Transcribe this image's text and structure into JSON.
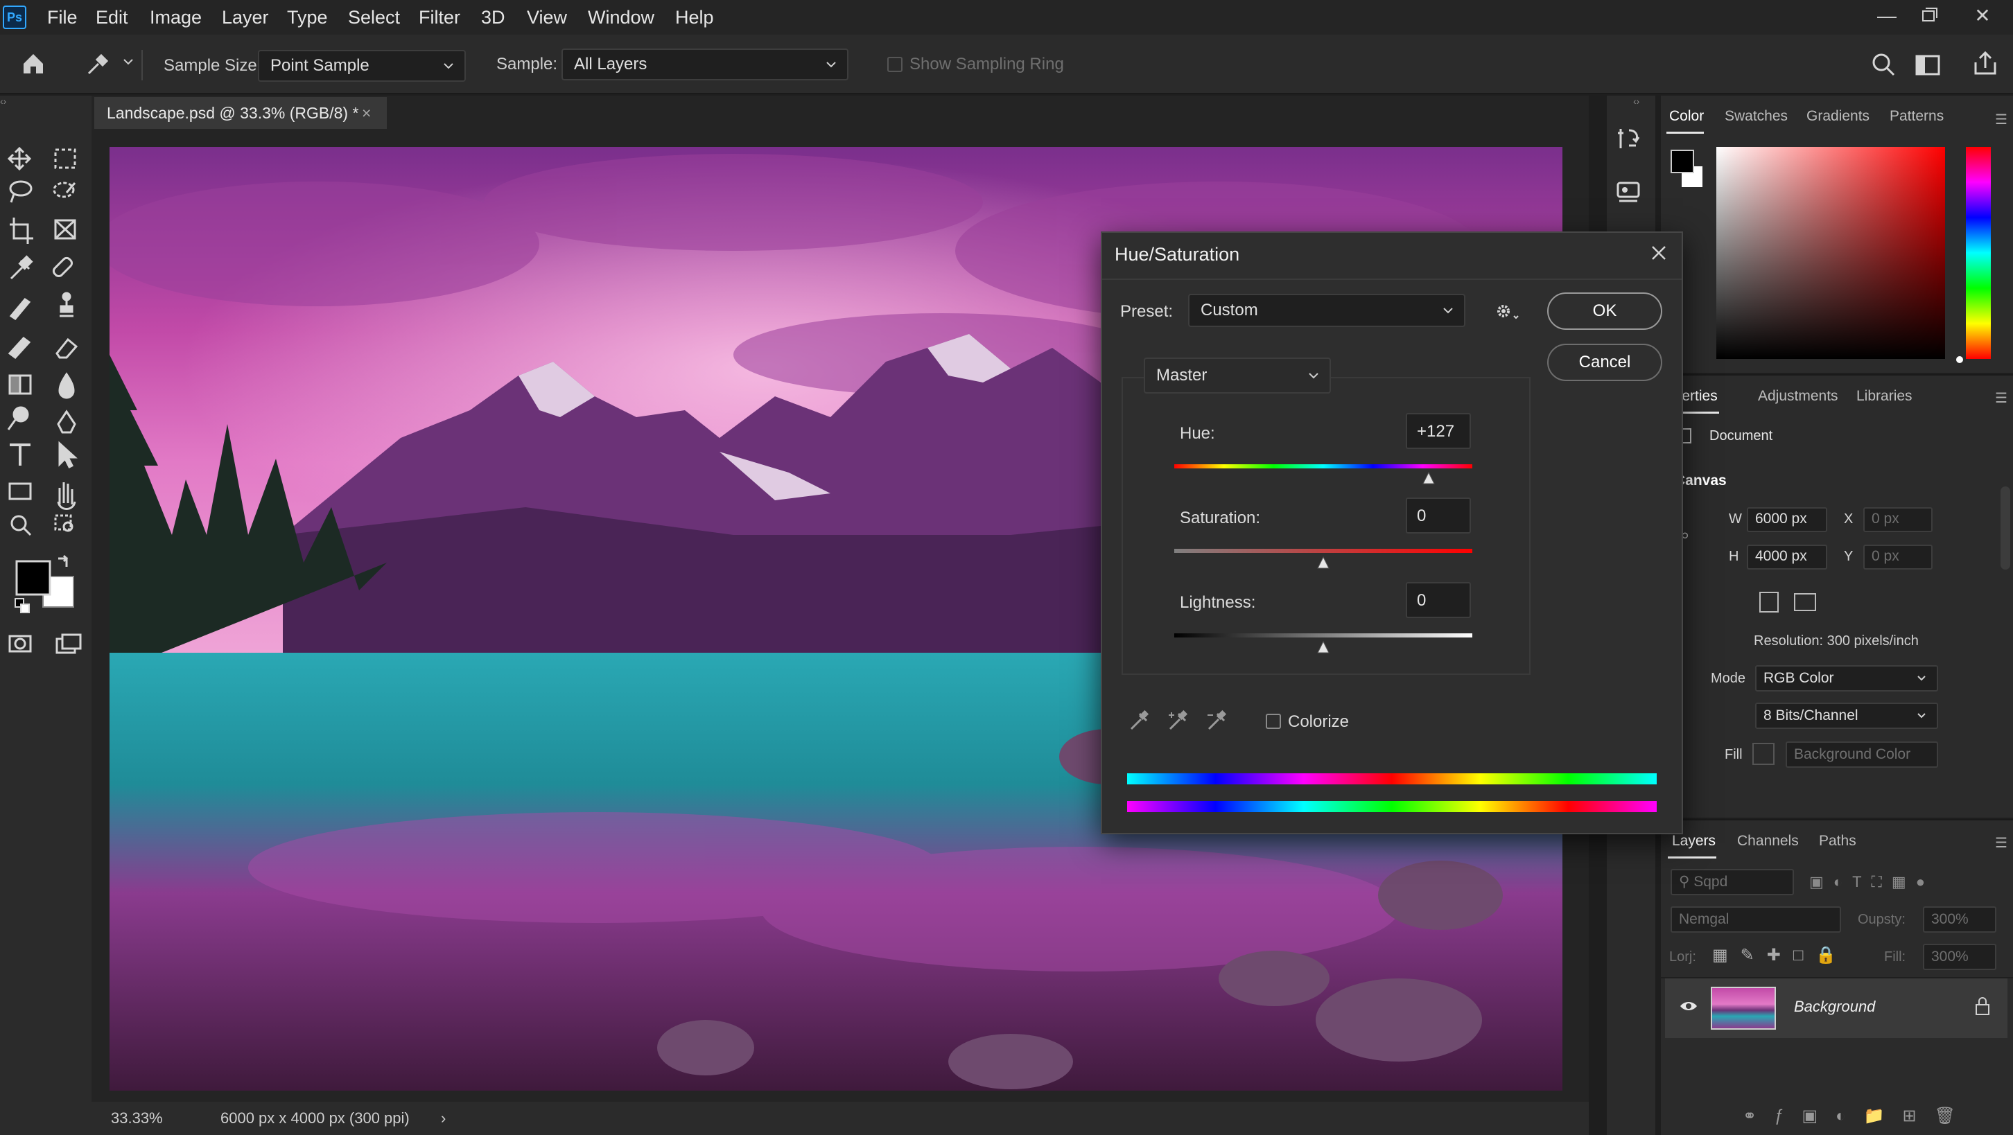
{
  "app": {
    "logo": "Ps"
  },
  "menu": [
    "File",
    "Edit",
    "Image",
    "Layer",
    "Type",
    "Select",
    "Filter",
    "3D",
    "View",
    "Window",
    "Help"
  ],
  "options": {
    "sample_size_label": "Sample Size:",
    "sample_size_value": "Point Sample",
    "sample_label": "Sample:",
    "sample_value": "All Layers",
    "sampling_ring_label": "Show Sampling Ring"
  },
  "document": {
    "tab_title": "Landscape.psd @ 33.3% (RGB/8) *",
    "zoom": "33.33%",
    "info": "6000 px x 4000 px (300 ppi)"
  },
  "color_panel": {
    "tabs": [
      "Color",
      "Swatches",
      "Gradients",
      "Patterns"
    ],
    "active_tab": "Color"
  },
  "properties_panel": {
    "tabs": [
      "roperties",
      "Adjustments",
      "Libraries"
    ],
    "document_label": "Document",
    "canvas_label": "Canvas",
    "w_label": "W",
    "w_value": "6000 px",
    "h_label": "H",
    "h_value": "4000 px",
    "x_label": "X",
    "x_value": "0 px",
    "y_label": "Y",
    "y_value": "0 px",
    "resolution": "Resolution: 300 pixels/inch",
    "mode_label": "Mode",
    "mode_value": "RGB Color",
    "bits_value": "8 Bits/Channel",
    "fill_label": "Fill",
    "fill_value": "Background Color"
  },
  "layers_panel": {
    "tabs": [
      "Layers",
      "Channels",
      "Paths"
    ],
    "search_placeholder": "Sqpd",
    "blend_mode": "Nemgal",
    "opacity_label": "Oupsty:",
    "opacity_value": "300%",
    "lock_label": "Lorj:",
    "fill_label": "Fill:",
    "fill_value": "300%",
    "layer_name": "Background"
  },
  "dialog": {
    "title": "Hue/Saturation",
    "preset_label": "Preset:",
    "preset_value": "Custom",
    "ok_label": "OK",
    "cancel_label": "Cancel",
    "channel_value": "Master",
    "hue_label": "Hue:",
    "hue_value": "+127",
    "hue_slider": 127,
    "saturation_label": "Saturation:",
    "saturation_value": "0",
    "saturation_slider": 0,
    "lightness_label": "Lightness:",
    "lightness_value": "0",
    "lightness_slider": 0,
    "colorize_label": "Colorize"
  },
  "colors": {
    "accent": "#31a8ff",
    "background": "#1e1e1e",
    "panel": "#2b2b2b"
  }
}
